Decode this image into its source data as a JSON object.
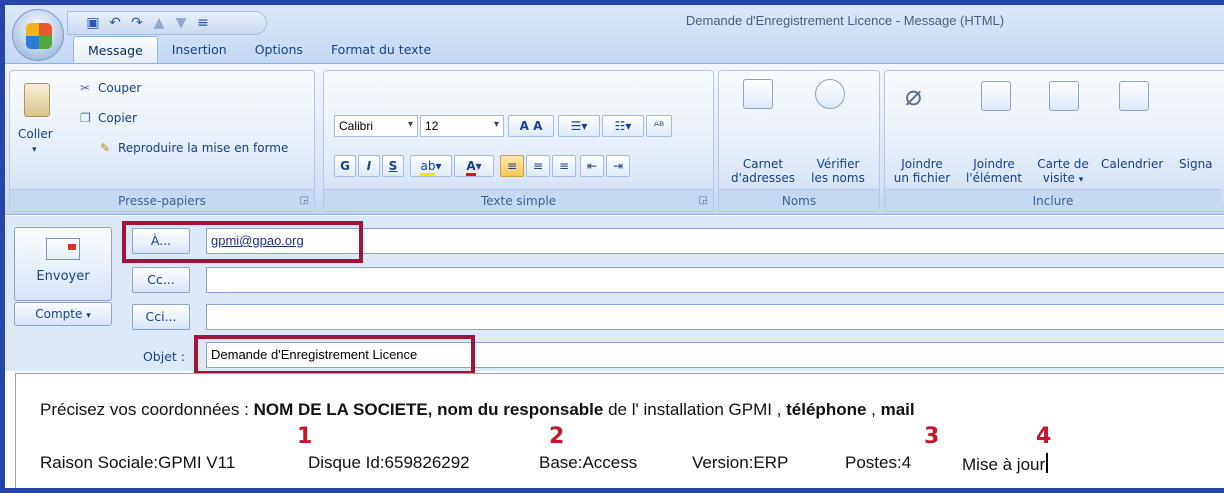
{
  "window": {
    "title": "Demande d'Enregistrement Licence - Message (HTML)"
  },
  "tabs": [
    "Message",
    "Insertion",
    "Options",
    "Format du texte"
  ],
  "ribbon": {
    "clipboard": {
      "label": "Presse-papiers",
      "paste": "Coller",
      "cut": "Couper",
      "copy": "Copier",
      "format_painter": "Reproduire la mise en forme"
    },
    "text": {
      "label": "Texte simple",
      "font": "Calibri",
      "size": "12",
      "bold": "G",
      "italic": "I",
      "underline": "S"
    },
    "names": {
      "label": "Noms",
      "address_book": [
        "Carnet",
        "d'adresses"
      ],
      "check_names": [
        "Vérifier",
        "les noms"
      ]
    },
    "include": {
      "label": "Inclure",
      "attach_file": [
        "Joindre",
        "un fichier"
      ],
      "attach_item": [
        "Joindre",
        "l'élément"
      ],
      "business_card": [
        "Carte de",
        "visite"
      ],
      "calendar": "Calendrier",
      "signature": "Signa"
    }
  },
  "header": {
    "send": "Envoyer",
    "account": "Compte",
    "to_button": "À...",
    "cc_button": "Cc...",
    "bcc_button": "Cci...",
    "to_value": "gpmi@gpao.org",
    "cc_value": "",
    "bcc_value": "",
    "subject_label": "Objet :",
    "subject_value": "Demande d'Enregistrement Licence"
  },
  "body": {
    "intro": "Précisez vos coordonnées : ",
    "company": "NOM DE LA SOCIETE, nom du responsable",
    "mid": " de l' installation GPMI , ",
    "phone": "téléphone",
    "sep": " , ",
    "mail": "mail",
    "fields": [
      "Raison Sociale:GPMI V11",
      "Disque Id:659826292",
      "Base:Access",
      "Version:ERP",
      "Postes:4",
      "Mise à jour"
    ],
    "annotations": [
      "1",
      "2",
      "3",
      "4"
    ]
  },
  "colors": {
    "highlight": "#a0143c",
    "annotation": "#c81428",
    "frame": "#2546a8"
  }
}
